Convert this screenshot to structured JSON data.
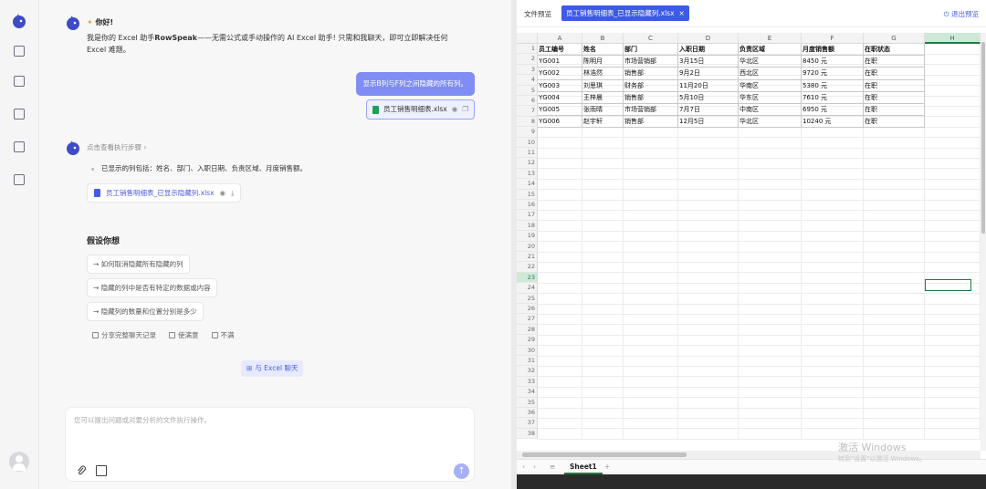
{
  "chat": {
    "greeting_title": "你好!",
    "greeting_body_prefix": "我是你的 Excel 助手",
    "greeting_brand": "RowSpeak",
    "greeting_body_suffix": "——无需公式或手动操作的 AI Excel 助手! 只需和我聊天，即可立即解决任何 Excel 难题。",
    "user_message": "显示B列与F列之间隐藏的所有列。",
    "user_file": "员工销售明细表.xlsx",
    "steps_link": "点击查看执行步骤",
    "result_text": "已显示的列包括：姓名、部门、入职日期、负责区域、月度销售额。",
    "result_file": "员工销售明细表_已显示隐藏列.xlsx",
    "assume_title": "假设你想",
    "suggestions": [
      "→ 如何取消隐藏所有隐藏的列",
      "→ 隐藏的列中是否有特定的数据或内容",
      "→ 隐藏列的数量和位置分别是多少"
    ],
    "actions": {
      "share": "分享完整聊天记录",
      "like": "使满意",
      "dislike": "不满"
    },
    "chat_excel": "与 Excel 聊天",
    "input_placeholder": "您可以提出问题或对要分析的文件执行操作。",
    "send_symbol": "↑"
  },
  "preview": {
    "label": "文件预览",
    "tab_name": "员工销售明细表_已显示隐藏列.xlsx",
    "tab_close": "×",
    "exit": "退出预览",
    "columns": [
      "A",
      "B",
      "C",
      "D",
      "E",
      "F",
      "G",
      "H"
    ],
    "active_column": "H",
    "active_row": 23,
    "row_count": 38,
    "headers": [
      "员工编号",
      "姓名",
      "部门",
      "入职日期",
      "负责区域",
      "月度销售额",
      "在职状态"
    ],
    "rows": [
      [
        "YG001",
        "陈明月",
        "市场营销部",
        "3月15日",
        "华北区",
        "8450 元",
        "在职"
      ],
      [
        "YG002",
        "林浩然",
        "销售部",
        "9月2日",
        "西北区",
        "9720 元",
        "在职"
      ],
      [
        "YG003",
        "刘思琪",
        "财务部",
        "11月20日",
        "华南区",
        "5380 元",
        "在职"
      ],
      [
        "YG004",
        "王梓晨",
        "销售部",
        "5月10日",
        "华东区",
        "7610 元",
        "在职"
      ],
      [
        "YG005",
        "张雨晴",
        "市场营销部",
        "7月7日",
        "中南区",
        "6950 元",
        "在职"
      ],
      [
        "YG006",
        "赵宇轩",
        "销售部",
        "12月5日",
        "华北区",
        "10240 元",
        "在职"
      ]
    ],
    "sheet_tab": "Sheet1",
    "watermark_title": "激活 Windows",
    "watermark_sub": "转到\"设置\"以激活 Windows。"
  },
  "colors": {
    "accent": "#3d5ae6",
    "user_bubble": "#7f8df5",
    "excel_green": "#1e7a44"
  }
}
